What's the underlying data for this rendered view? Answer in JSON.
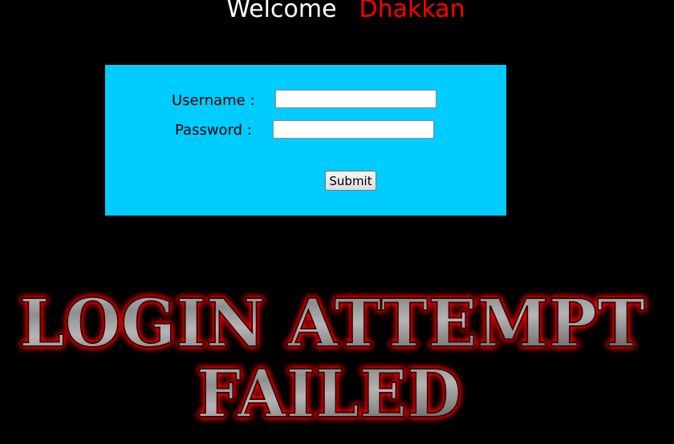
{
  "header": {
    "welcome_text": "Welcome",
    "user_name": "Dhakkan"
  },
  "login_form": {
    "username_label": "Username :",
    "username_value": "",
    "password_label": "Password :",
    "password_value": "",
    "submit_label": "Submit"
  },
  "banner": {
    "line1": "LOGIN ATTEMPT",
    "line2": "FAILED"
  },
  "colors": {
    "background": "#000000",
    "form_background": "#00ccff",
    "user_name": "#ff0000",
    "banner_glow": "#ff0000"
  }
}
